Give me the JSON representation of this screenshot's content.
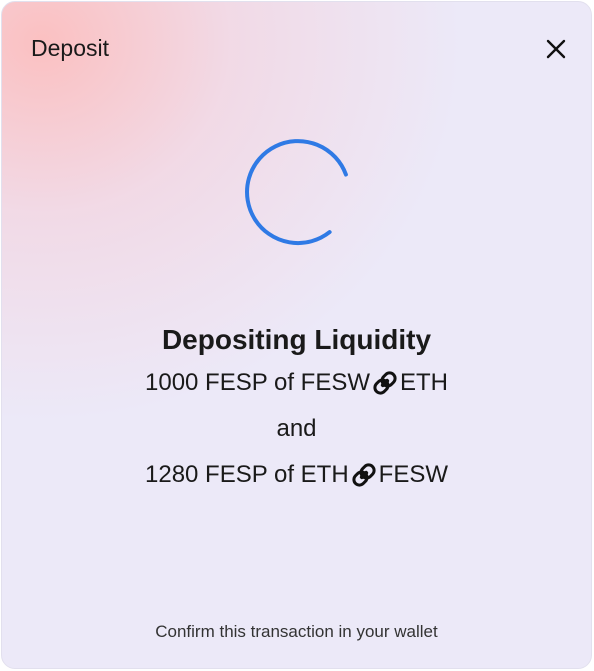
{
  "modal": {
    "title": "Deposit",
    "close_icon": "close-icon",
    "spinner_icon": "loading-spinner-icon",
    "heading": "Depositing Liquidity",
    "line1": {
      "amount": "1000 FESP of FESW",
      "pair_link_icon": "chain-link-icon",
      "pair_token": "ETH"
    },
    "conjunction": "and",
    "line2": {
      "amount": "1280 FESP of ETH",
      "pair_link_icon": "chain-link-icon",
      "pair_token": "FESW"
    },
    "footer": "Confirm this transaction in your wallet"
  },
  "colors": {
    "spinner": "#2f7ae5",
    "text": "#1a1a1a",
    "background": "#ece9f8",
    "gradient_accent": "#fcbebe"
  }
}
